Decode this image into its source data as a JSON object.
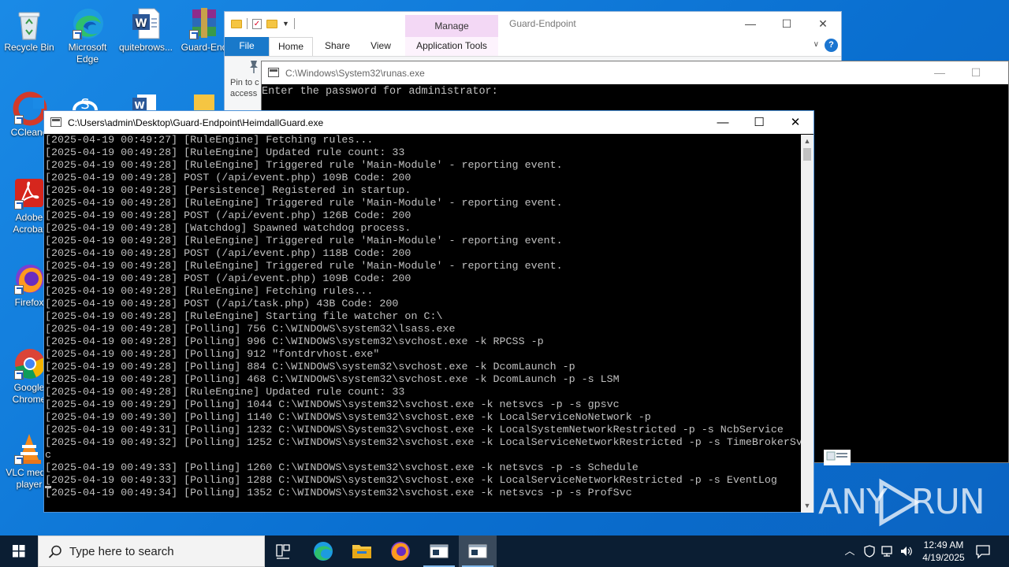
{
  "desktop": {
    "icons": [
      {
        "label": "Recycle Bin"
      },
      {
        "label": "Microsoft Edge"
      },
      {
        "label": "quitebrows..."
      },
      {
        "label": "Guard-End"
      },
      {
        "label": "CCleane"
      },
      {
        "label": "Adobe Acrobat"
      },
      {
        "label": "Firefox"
      },
      {
        "label": "Google Chrome"
      },
      {
        "label": "VLC media player"
      }
    ]
  },
  "explorer": {
    "title": "Guard-Endpoint",
    "manage_tab": "Manage",
    "tabs": [
      "File",
      "Home",
      "Share",
      "View",
      "Application Tools"
    ],
    "pin_label": "Pin to c\naccess",
    "window_buttons": [
      "—",
      "☐",
      "✕"
    ],
    "help": "?"
  },
  "runas": {
    "title": "C:\\Windows\\System32\\runas.exe",
    "text": "Enter the password for administrator:",
    "window_buttons": [
      "—",
      "☐"
    ]
  },
  "console": {
    "title": "C:\\Users\\admin\\Desktop\\Guard-Endpoint\\HeimdallGuard.exe",
    "window_buttons": [
      "—",
      "☐",
      "✕"
    ],
    "lines": [
      "[2025-04-19 00:49:27] [RuleEngine] Fetching rules...",
      "[2025-04-19 00:49:28] [RuleEngine] Updated rule count: 33",
      "[2025-04-19 00:49:28] [RuleEngine] Triggered rule 'Main-Module' - reporting event.",
      "[2025-04-19 00:49:28] POST (/api/event.php) 109B Code: 200",
      "[2025-04-19 00:49:28] [Persistence] Registered in startup.",
      "[2025-04-19 00:49:28] [RuleEngine] Triggered rule 'Main-Module' - reporting event.",
      "[2025-04-19 00:49:28] POST (/api/event.php) 126B Code: 200",
      "[2025-04-19 00:49:28] [Watchdog] Spawned watchdog process.",
      "[2025-04-19 00:49:28] [RuleEngine] Triggered rule 'Main-Module' - reporting event.",
      "[2025-04-19 00:49:28] POST (/api/event.php) 118B Code: 200",
      "[2025-04-19 00:49:28] [RuleEngine] Triggered rule 'Main-Module' - reporting event.",
      "[2025-04-19 00:49:28] POST (/api/event.php) 109B Code: 200",
      "[2025-04-19 00:49:28] [RuleEngine] Fetching rules...",
      "[2025-04-19 00:49:28] POST (/api/task.php) 43B Code: 200",
      "[2025-04-19 00:49:28] [RuleEngine] Starting file watcher on C:\\",
      "[2025-04-19 00:49:28] [Polling] 756 C:\\WINDOWS\\system32\\lsass.exe",
      "[2025-04-19 00:49:28] [Polling] 996 C:\\WINDOWS\\system32\\svchost.exe -k RPCSS -p",
      "[2025-04-19 00:49:28] [Polling] 912 \"fontdrvhost.exe\"",
      "[2025-04-19 00:49:28] [Polling] 884 C:\\WINDOWS\\system32\\svchost.exe -k DcomLaunch -p",
      "[2025-04-19 00:49:28] [Polling] 468 C:\\WINDOWS\\system32\\svchost.exe -k DcomLaunch -p -s LSM",
      "[2025-04-19 00:49:28] [RuleEngine] Updated rule count: 33",
      "[2025-04-19 00:49:29] [Polling] 1044 C:\\WINDOWS\\system32\\svchost.exe -k netsvcs -p -s gpsvc",
      "[2025-04-19 00:49:30] [Polling] 1140 C:\\WINDOWS\\system32\\svchost.exe -k LocalServiceNoNetwork -p",
      "[2025-04-19 00:49:31] [Polling] 1232 C:\\WINDOWS\\System32\\svchost.exe -k LocalSystemNetworkRestricted -p -s NcbService",
      "[2025-04-19 00:49:32] [Polling] 1252 C:\\WINDOWS\\system32\\svchost.exe -k LocalServiceNetworkRestricted -p -s TimeBrokerSv",
      "c",
      "[2025-04-19 00:49:33] [Polling] 1260 C:\\WINDOWS\\system32\\svchost.exe -k netsvcs -p -s Schedule",
      "[2025-04-19 00:49:33] [Polling] 1288 C:\\WINDOWS\\system32\\svchost.exe -k LocalServiceNetworkRestricted -p -s EventLog",
      "[2025-04-19 00:49:34] [Polling] 1352 C:\\WINDOWS\\system32\\svchost.exe -k netsvcs -p -s ProfSvc"
    ]
  },
  "watermark": {
    "left": "ANY",
    "right": "RUN"
  },
  "taskbar": {
    "search_placeholder": "Type here to search",
    "time": "12:49 AM",
    "date": "4/19/2025",
    "pinned": [
      "task-view",
      "edge",
      "file-explorer",
      "firefox",
      "console",
      "console-active"
    ]
  },
  "colors": {
    "desktop_bg": "#0f78d4",
    "taskbar_bg": "#0b1e33",
    "console_text": "#c0c0c0",
    "manage_tab": "#f3d8f5",
    "file_tab": "#1979ca"
  }
}
